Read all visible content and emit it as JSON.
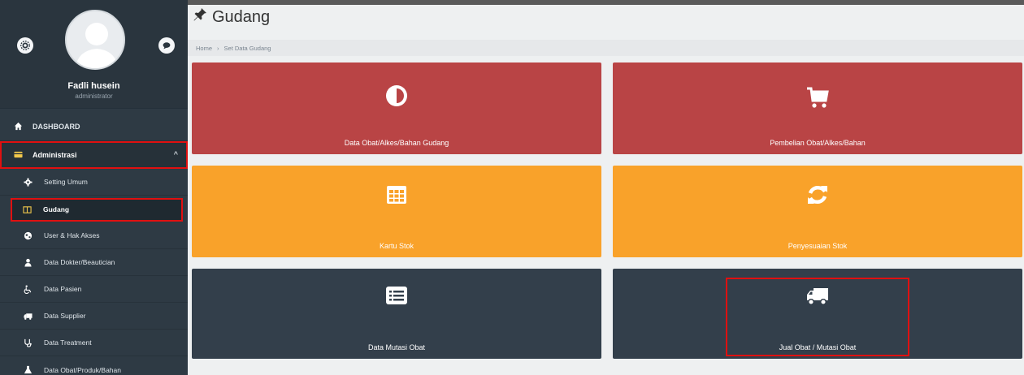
{
  "profile": {
    "name": "Fadli husein",
    "role": "administrator"
  },
  "nav": {
    "dashboard": "DASHBOARD",
    "administrasi": "Administrasi",
    "sub": [
      {
        "label": "Setting Umum",
        "icon": "gear-icon"
      },
      {
        "label": "Gudang",
        "icon": "columns-icon"
      },
      {
        "label": "User & Hak Akses",
        "icon": "globe-icon"
      },
      {
        "label": "Data Dokter/Beautician",
        "icon": "user-md-icon"
      },
      {
        "label": "Data Pasien",
        "icon": "wheelchair-icon"
      },
      {
        "label": "Data Supplier",
        "icon": "truck-icon"
      },
      {
        "label": "Data Treatment",
        "icon": "stethoscope-icon"
      },
      {
        "label": "Data Obat/Produk/Bahan",
        "icon": "flask-icon"
      }
    ]
  },
  "page": {
    "title": "Gudang",
    "breadcrumb": {
      "home": "Home",
      "separator": "›",
      "current": "Set Data Gudang"
    }
  },
  "tiles": [
    {
      "label": "Data Obat/Alkes/Bahan Gudang",
      "icon": "adjust-icon",
      "color": "#b94445"
    },
    {
      "label": "Pembelian Obat/Alkes/Bahan",
      "icon": "cart-icon",
      "color": "#b94445"
    },
    {
      "label": "Kartu Stok",
      "icon": "grid-icon",
      "color": "#f9a22a"
    },
    {
      "label": "Penyesuaian Stok",
      "icon": "refresh-icon",
      "color": "#f9a22a"
    },
    {
      "label": "Data Mutasi Obat",
      "icon": "list-icon",
      "color": "#333f4b"
    },
    {
      "label": "Jual Obat / Mutasi Obat",
      "icon": "truck-icon",
      "color": "#333f4b"
    }
  ]
}
